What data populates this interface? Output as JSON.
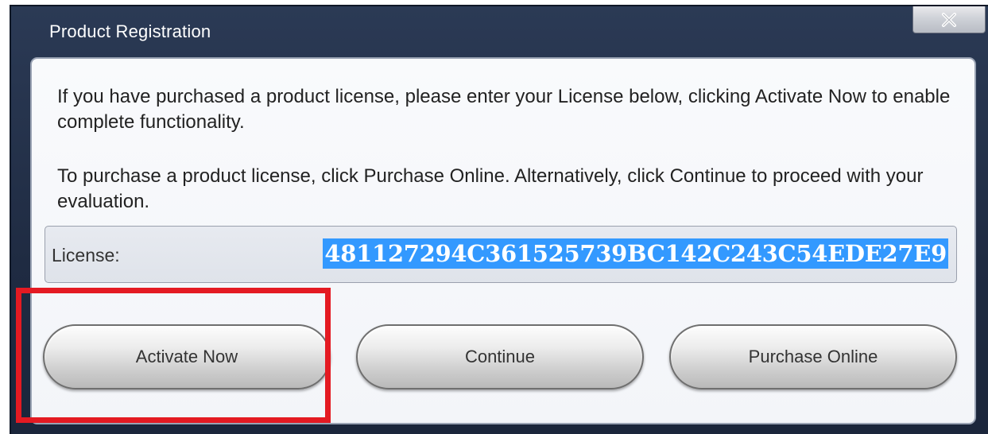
{
  "window": {
    "title": "Product Registration",
    "close_icon": "close-x-icon"
  },
  "content": {
    "paragraph1": "If you have purchased a product license, please enter your License below, clicking Activate Now to enable complete functionality.",
    "paragraph2": "To purchase a product license, click Purchase Online. Alternatively, click Continue to proceed with your evaluation."
  },
  "license": {
    "label": "License:",
    "value": "481127294C361525739BC142C243C54EDE27E9",
    "selection_color": "#3399ff"
  },
  "buttons": {
    "activate": "Activate Now",
    "continue": "Continue",
    "purchase": "Purchase Online"
  },
  "colors": {
    "titlebar": "#1f2b42",
    "highlight_box": "#e41a22"
  }
}
